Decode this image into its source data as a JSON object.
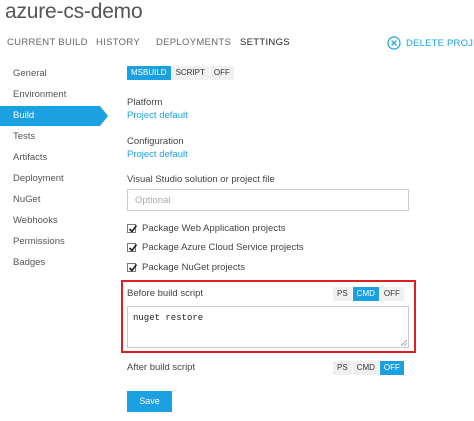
{
  "app": {
    "title": "azure-cs-demo"
  },
  "topnav": {
    "tabs": [
      "CURRENT BUILD",
      "HISTORY",
      "DEPLOYMENTS",
      "SETTINGS"
    ],
    "active": "SETTINGS",
    "delete_label": "DELETE PROJECT",
    "delete_icon": "close-circle-icon"
  },
  "sidebar": {
    "items": [
      "General",
      "Environment",
      "Build",
      "Tests",
      "Artifacts",
      "Deployment",
      "NuGet",
      "Webhooks",
      "Permissions",
      "Badges"
    ],
    "active": "Build"
  },
  "build": {
    "mode_options": [
      "MSBUILD",
      "SCRIPT",
      "OFF"
    ],
    "mode_selected": "MSBUILD",
    "platform_label": "Platform",
    "platform_value": "Project default",
    "configuration_label": "Configuration",
    "configuration_value": "Project default",
    "solution_label": "Visual Studio solution or project file",
    "solution_placeholder": "Optional",
    "solution_value": "",
    "checkboxes": [
      {
        "label": "Package Web Application projects",
        "checked": true
      },
      {
        "label": "Package Azure Cloud Service projects",
        "checked": true
      },
      {
        "label": "Package NuGet projects",
        "checked": true
      }
    ],
    "before_script": {
      "label": "Before build script",
      "options": [
        "PS",
        "CMD",
        "OFF"
      ],
      "selected": "CMD",
      "value": "nuget restore"
    },
    "after_script": {
      "label": "After build script",
      "options": [
        "PS",
        "CMD",
        "OFF"
      ],
      "selected": "OFF"
    },
    "save_label": "Save"
  },
  "colors": {
    "accent": "#1ba1e2",
    "highlight": "#e02020"
  }
}
